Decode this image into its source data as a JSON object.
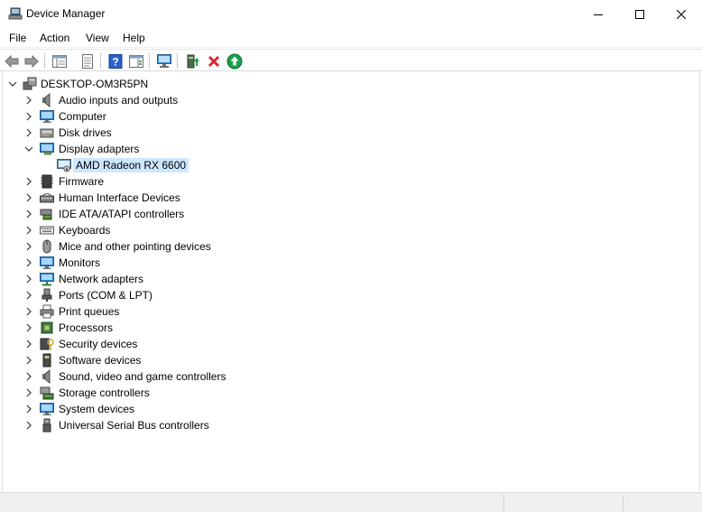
{
  "window": {
    "title": "Device Manager",
    "icon": "device-manager-icon"
  },
  "menu": [
    {
      "label": "File"
    },
    {
      "label": "Action"
    },
    {
      "label": "View"
    },
    {
      "label": "Help"
    }
  ],
  "toolbar": {
    "buttons": [
      "back-icon",
      "forward-icon",
      "show-hide-console-tree-icon",
      "properties-icon",
      "help-icon",
      "action-pane-icon",
      "scan-hardware-changes-icon",
      "update-driver-icon",
      "uninstall-device-icon",
      "enable-device-icon"
    ]
  },
  "tree": {
    "root": {
      "label": "DESKTOP-OM3R5PN",
      "expanded": true
    },
    "categories": [
      {
        "label": "Audio inputs and outputs",
        "icon": "speaker-icon",
        "expanded": false
      },
      {
        "label": "Computer",
        "icon": "computer-icon",
        "expanded": false
      },
      {
        "label": "Disk drives",
        "icon": "disk-drive-icon",
        "expanded": false
      },
      {
        "label": "Display adapters",
        "icon": "display-adapter-icon",
        "expanded": true
      },
      {
        "label": "Firmware",
        "icon": "firmware-icon",
        "expanded": false
      },
      {
        "label": "Human Interface Devices",
        "icon": "hid-icon",
        "expanded": false
      },
      {
        "label": "IDE ATA/ATAPI controllers",
        "icon": "ide-controller-icon",
        "expanded": false
      },
      {
        "label": "Keyboards",
        "icon": "keyboard-icon",
        "expanded": false
      },
      {
        "label": "Mice and other pointing devices",
        "icon": "mouse-icon",
        "expanded": false
      },
      {
        "label": "Monitors",
        "icon": "monitor-icon",
        "expanded": false
      },
      {
        "label": "Network adapters",
        "icon": "network-adapter-icon",
        "expanded": false
      },
      {
        "label": "Ports (COM & LPT)",
        "icon": "port-icon",
        "expanded": false
      },
      {
        "label": "Print queues",
        "icon": "printer-icon",
        "expanded": false
      },
      {
        "label": "Processors",
        "icon": "processor-icon",
        "expanded": false
      },
      {
        "label": "Security devices",
        "icon": "security-device-icon",
        "expanded": false
      },
      {
        "label": "Software devices",
        "icon": "software-device-icon",
        "expanded": false
      },
      {
        "label": "Sound, video and game controllers",
        "icon": "sound-controller-icon",
        "expanded": false
      },
      {
        "label": "Storage controllers",
        "icon": "storage-controller-icon",
        "expanded": false
      },
      {
        "label": "System devices",
        "icon": "system-device-icon",
        "expanded": false
      },
      {
        "label": "Universal Serial Bus controllers",
        "icon": "usb-icon",
        "expanded": false
      }
    ],
    "display_children": [
      {
        "label": "AMD Radeon RX 6600",
        "icon": "display-adapter-device-icon",
        "selected": true
      }
    ]
  },
  "colors": {
    "selection": "#cce8ff",
    "accent_blue": "#1e73be",
    "delete_red": "#d9272e",
    "enable_green": "#15a04a"
  }
}
